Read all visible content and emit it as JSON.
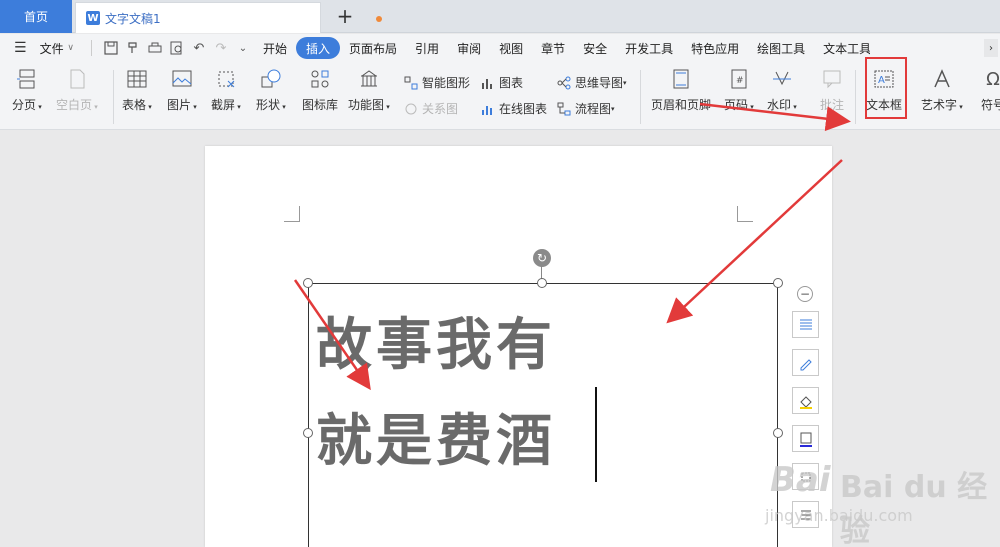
{
  "tabs": {
    "home": "首页",
    "doc_icon": "W",
    "doc_title": "文字文稿1",
    "new_tab": "+"
  },
  "menubar": {
    "file": "文件",
    "items": [
      "开始",
      "插入",
      "页面布局",
      "引用",
      "审阅",
      "视图",
      "章节",
      "安全",
      "开发工具",
      "特色应用",
      "绘图工具",
      "文本工具"
    ],
    "active": "插入"
  },
  "ribbon": {
    "page_break": "分页",
    "blank_page": "空白页",
    "table": "表格",
    "picture": "图片",
    "screenshot": "截屏",
    "shape": "形状",
    "icon_lib": "图标库",
    "func_chart": "功能图",
    "smart_shape": "智能图形",
    "chart": "图表",
    "mind_map": "思维导图",
    "relation": "关系图",
    "online_chart": "在线图表",
    "flowchart": "流程图",
    "header_footer": "页眉和页脚",
    "page_number": "页码",
    "watermark": "水印",
    "comment": "批注",
    "textbox": "文本框",
    "art_text": "艺术字",
    "symbol": "符号"
  },
  "document": {
    "line1": "故事我有",
    "line2": "就是费酒"
  },
  "watermark": {
    "brand": "Bai du 经验",
    "url": "jingyan.baidu.com"
  },
  "colors": {
    "accent": "#3d7ddb",
    "annotation_red": "#e23a3a",
    "doc_text": "#6a6a6a"
  }
}
